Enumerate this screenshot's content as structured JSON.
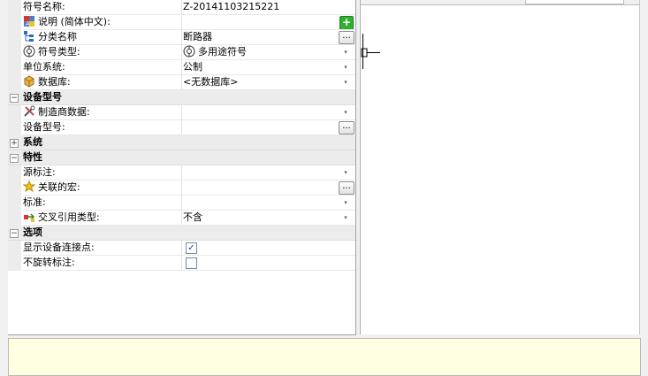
{
  "rows": [
    {
      "kind": "prop",
      "label": "符号名称:",
      "value": "Z-20141103215221",
      "icon": "",
      "value_icon": "",
      "btn": ""
    },
    {
      "kind": "prop",
      "label": "说明 (简体中文):",
      "value": "",
      "icon": "language-flag-icon",
      "value_icon": "",
      "btn": "add"
    },
    {
      "kind": "prop",
      "label": "分类名称",
      "value": "断路器",
      "icon": "tree-hierarchy-icon",
      "value_icon": "",
      "btn": "dots"
    },
    {
      "kind": "prop",
      "label": "符号类型:",
      "value": "多用途符号",
      "icon": "symbol-type-icon",
      "value_icon": "symbol-type-icon",
      "btn": "drop"
    },
    {
      "kind": "prop",
      "label": "单位系统:",
      "value": "公制",
      "icon": "",
      "value_icon": "",
      "btn": "drop"
    },
    {
      "kind": "prop",
      "label": "数据库:",
      "value": "<无数据库>",
      "icon": "database-box-icon",
      "value_icon": "",
      "btn": "drop"
    },
    {
      "kind": "cat",
      "label": "设备型号",
      "expander": "−"
    },
    {
      "kind": "prop",
      "label": "制造商数据:",
      "value": "",
      "icon": "tools-icon",
      "value_icon": "",
      "btn": "drop"
    },
    {
      "kind": "prop",
      "label": "设备型号:",
      "value": "",
      "icon": "",
      "value_icon": "",
      "btn": "dots"
    },
    {
      "kind": "cat",
      "label": "系统",
      "expander": "+"
    },
    {
      "kind": "cat",
      "label": "特性",
      "expander": "−"
    },
    {
      "kind": "prop",
      "label": "源标注:",
      "value": "",
      "icon": "",
      "value_icon": "",
      "btn": "drop"
    },
    {
      "kind": "prop",
      "label": "关联的宏:",
      "value": "",
      "icon": "star-icon",
      "value_icon": "",
      "btn": "dots"
    },
    {
      "kind": "prop",
      "label": "标准:",
      "value": "",
      "icon": "",
      "value_icon": "",
      "btn": "drop"
    },
    {
      "kind": "prop",
      "label": "交叉引用类型:",
      "value": "不含",
      "icon": "cross-reference-icon",
      "value_icon": "",
      "btn": "drop"
    },
    {
      "kind": "cat",
      "label": "选项",
      "expander": "−"
    },
    {
      "kind": "check",
      "label": "显示设备连接点:",
      "checked": true
    },
    {
      "kind": "check",
      "label": "不旋转标注:",
      "checked": false
    }
  ],
  "buttons": {
    "dots": "...",
    "add": "+",
    "drop": "▾",
    "check": "✓"
  }
}
